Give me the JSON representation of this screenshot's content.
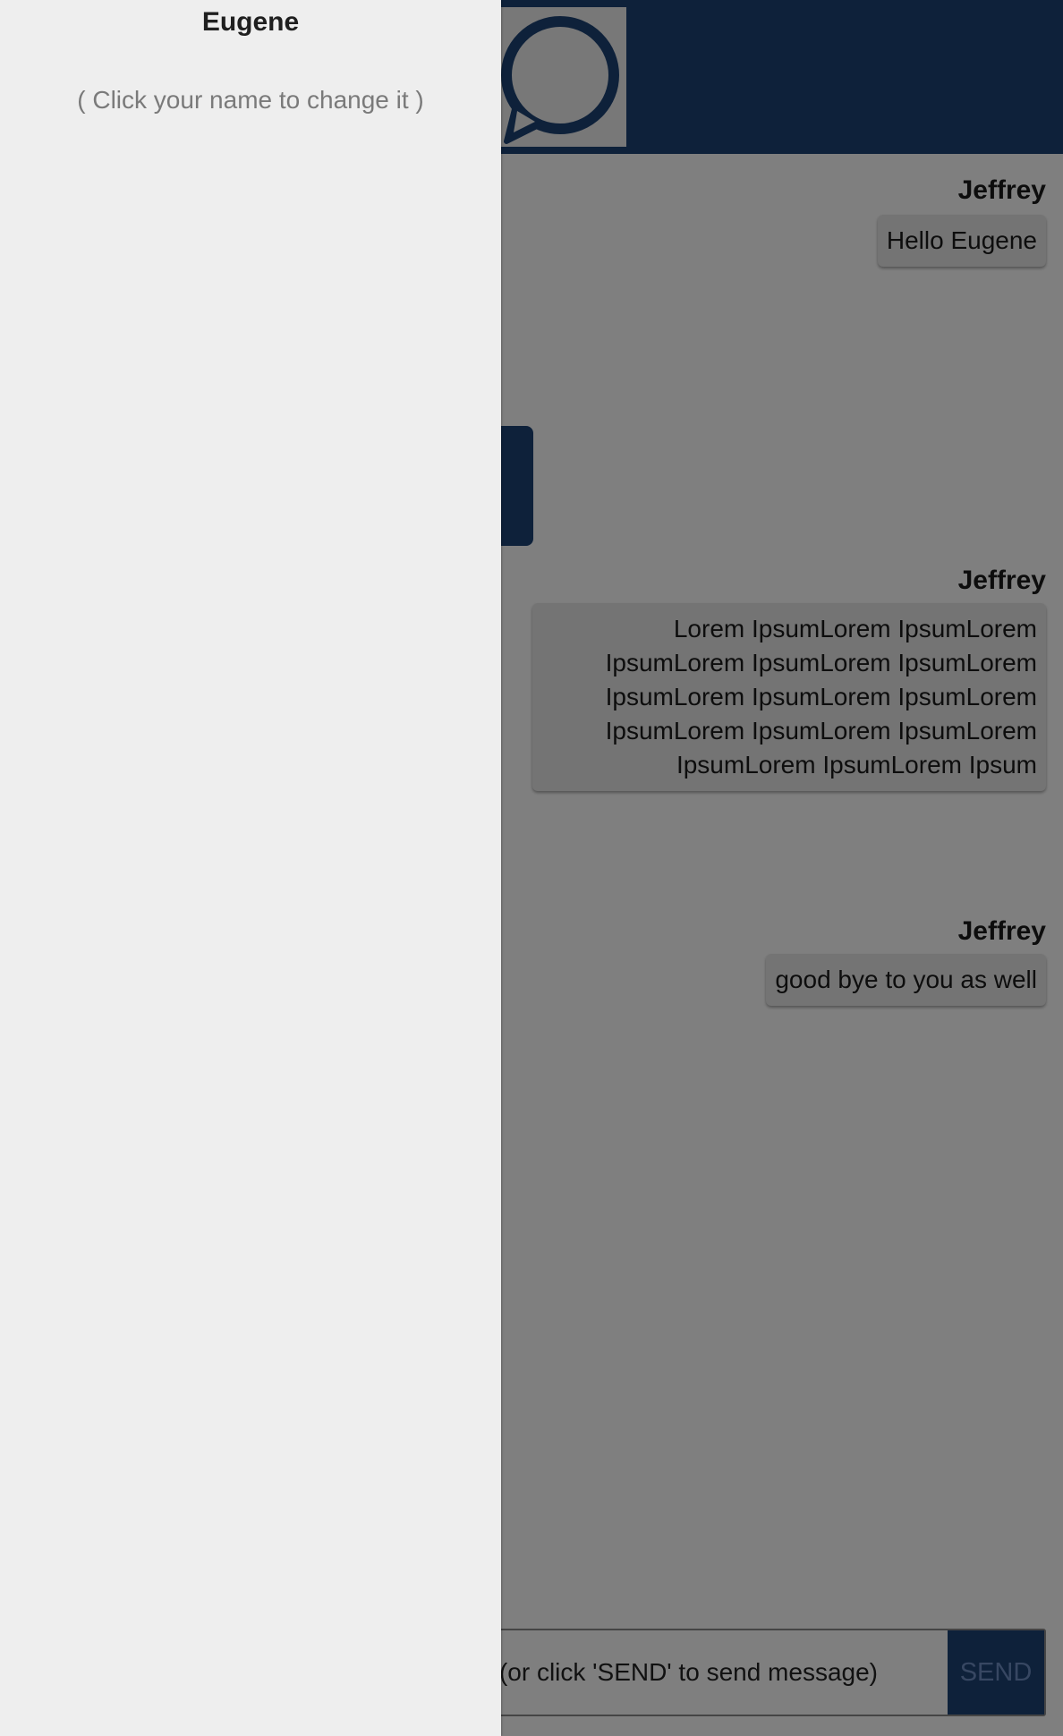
{
  "drawer": {
    "user_name": "Eugene",
    "hint": "( Click your name to change it )"
  },
  "header": {
    "logo_icon": "chat-bubble-icon"
  },
  "messages": [
    {
      "author": "Jeffrey",
      "text": "Hello Eugene"
    },
    {
      "author": "Jeffrey",
      "text": "Lorem IpsumLorem IpsumLorem IpsumLorem IpsumLorem IpsumLorem IpsumLorem IpsumLorem IpsumLorem IpsumLorem IpsumLorem IpsumLorem IpsumLorem IpsumLorem Ipsum"
    },
    {
      "author": "Jeffrey",
      "text": "good bye to you as well"
    }
  ],
  "composer": {
    "placeholder": "Press ENTER (or click 'SEND' to send message)",
    "send_label": "SEND"
  },
  "colors": {
    "brand": "#1c4275",
    "drawer_bg": "#eeeeee",
    "overlay": "rgba(0,0,0,0.5)"
  }
}
